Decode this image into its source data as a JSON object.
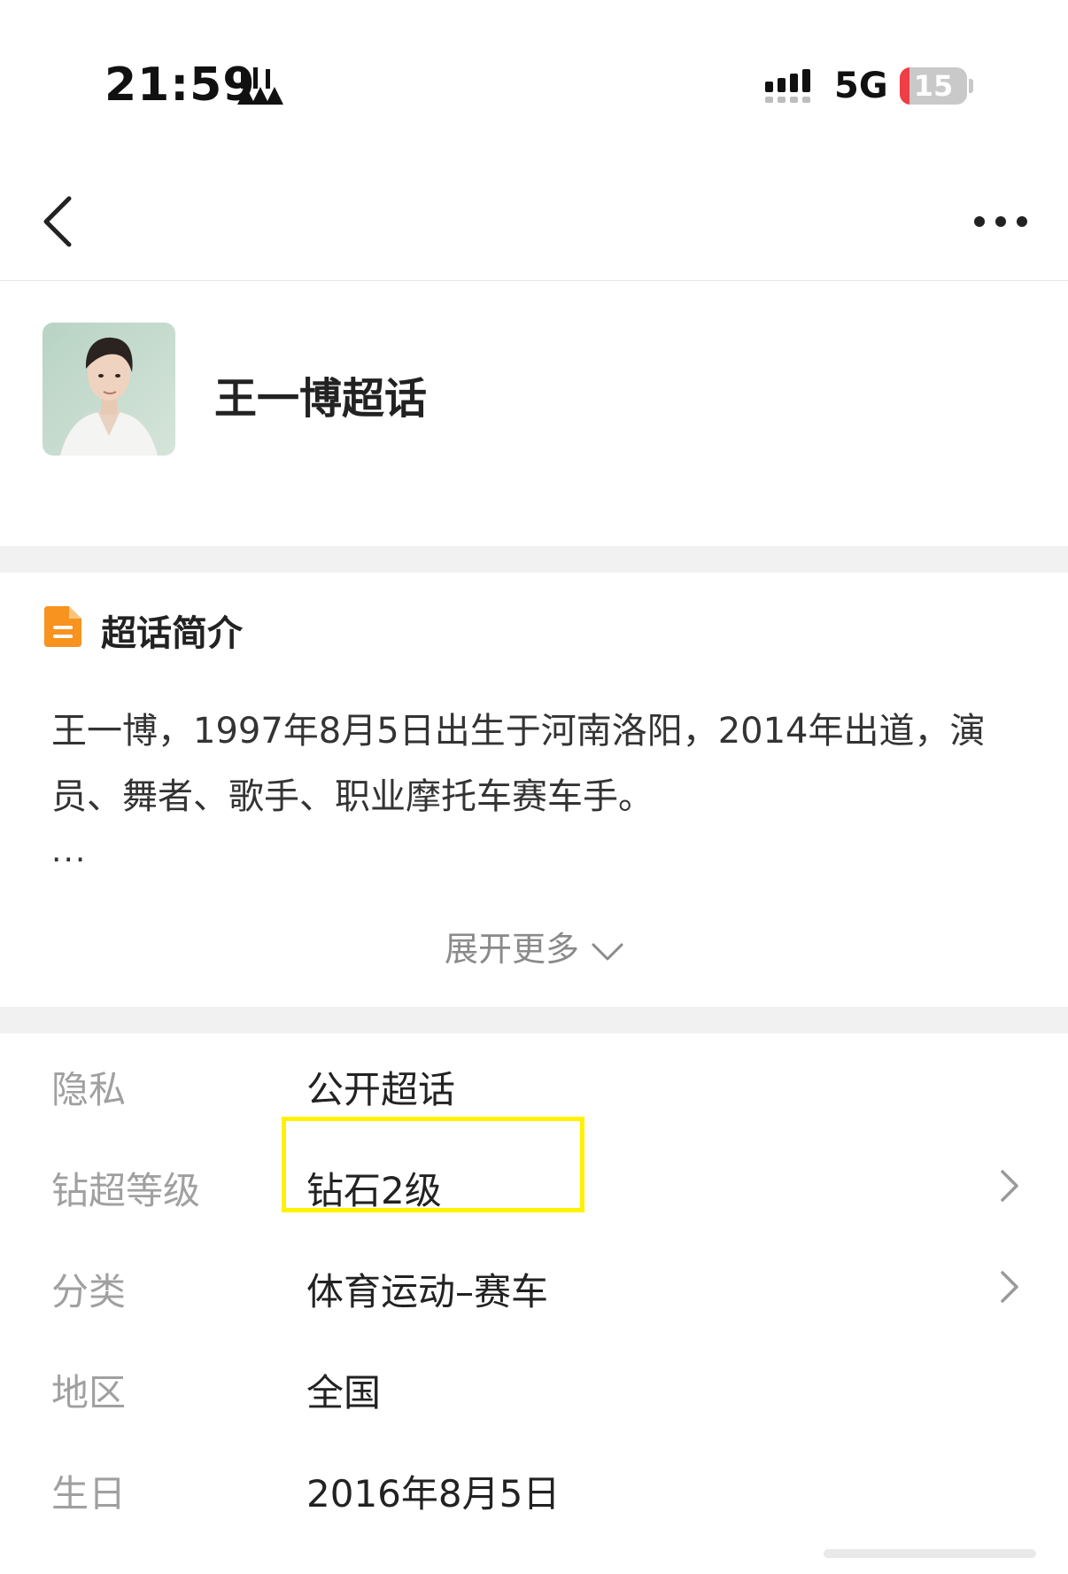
{
  "status_bar": {
    "time": "21:59",
    "network": "5G",
    "battery": "15",
    "battery_level": 0.15
  },
  "header": {
    "title": "王一博超话"
  },
  "intro": {
    "heading": "超话简介",
    "text": "王一博，1997年8月5日出生于河南洛阳，2014年出道，演员、舞者、歌手、职业摩托车赛车手。",
    "ellipsis": "...",
    "expand_label": "展开更多"
  },
  "info_rows": [
    {
      "label": "隐私",
      "value": "公开超话"
    },
    {
      "label": "钻超等级",
      "value": "钻石2级"
    },
    {
      "label": "分类",
      "value": "体育运动–赛车"
    },
    {
      "label": "地区",
      "value": "全国"
    },
    {
      "label": "生日",
      "value": "2016年8月5日"
    }
  ],
  "colors": {
    "highlight": "#fff200",
    "intro_icon": "#f7931e",
    "battery_low": "#ef3e45"
  }
}
